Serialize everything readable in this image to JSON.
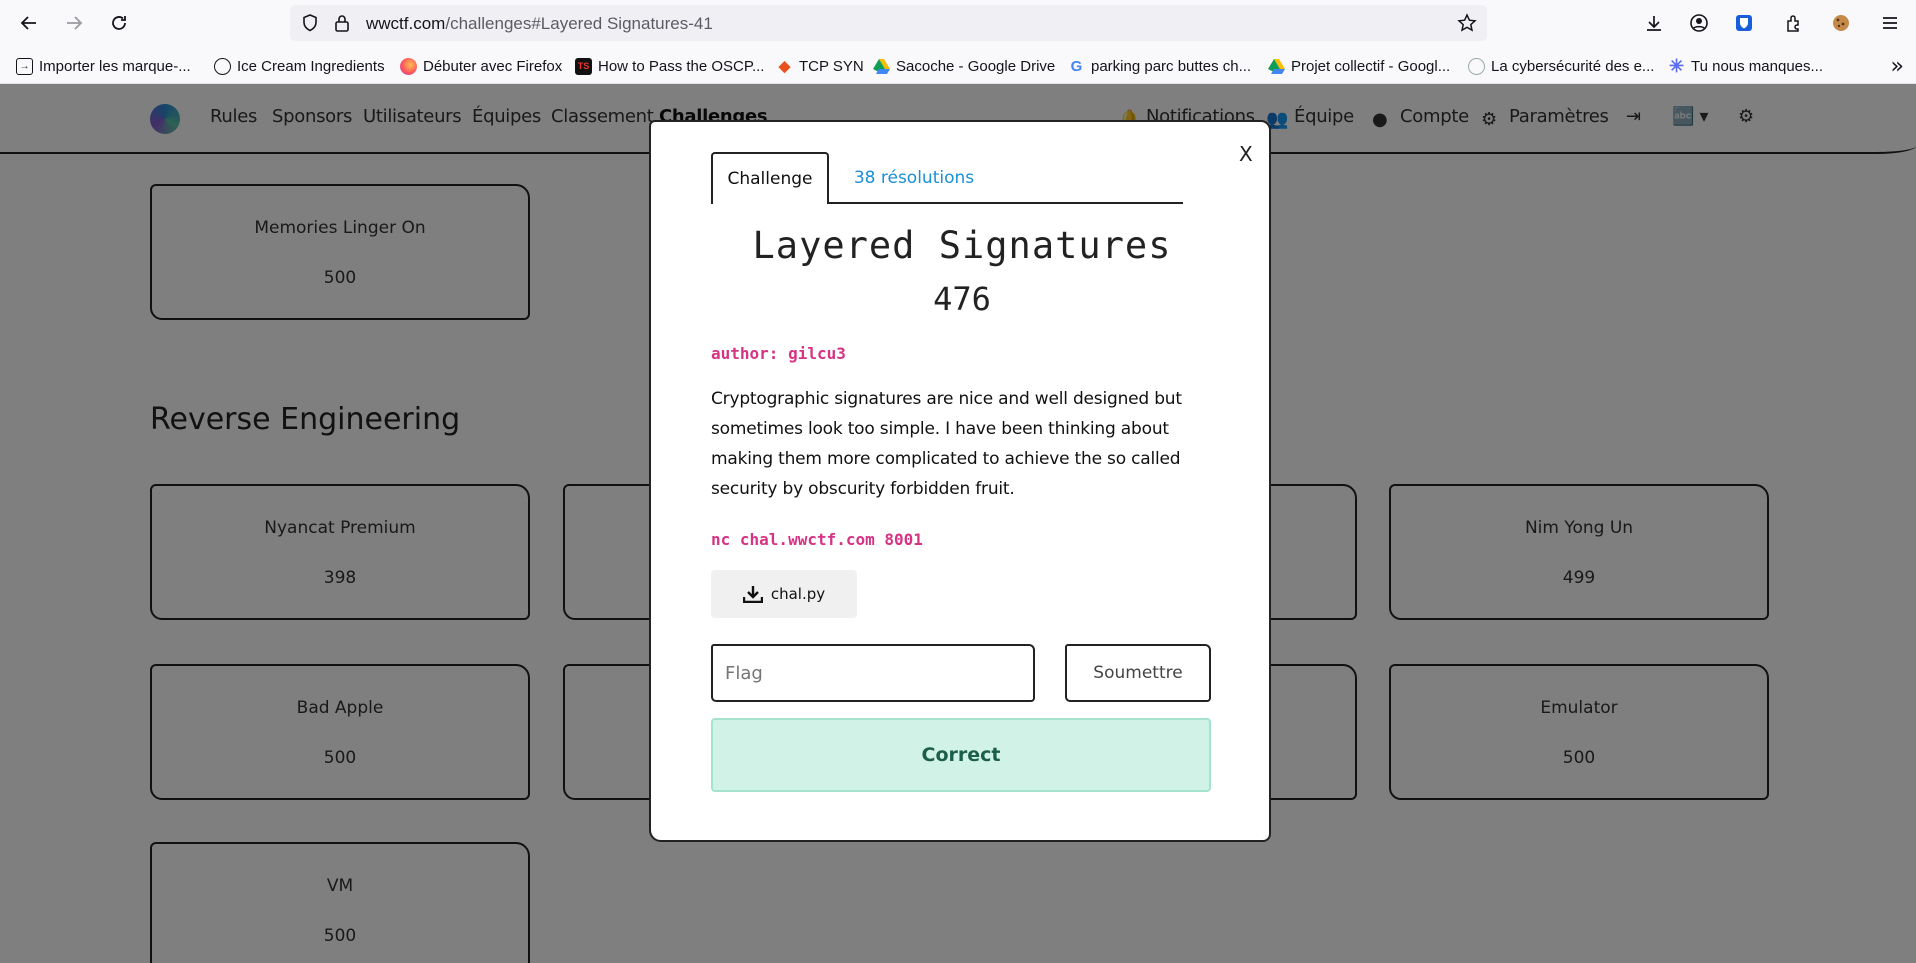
{
  "browser": {
    "url_host": "wwctf.com",
    "url_path": "/challenges#Layered Signatures-41",
    "icons": [
      "back-icon",
      "forward-icon",
      "reload-icon",
      "shield-icon",
      "lock-icon",
      "star-icon",
      "download-icon",
      "account-icon",
      "bitwarden-icon",
      "extensions-icon",
      "cookie-icon",
      "menu-icon"
    ],
    "bookmarks": [
      {
        "label": "Importer les marque-...",
        "icon": "import-icon"
      },
      {
        "label": "Ice Cream Ingredients",
        "icon": "globe-icon"
      },
      {
        "label": "Débuter avec Firefox",
        "icon": "firefox-icon"
      },
      {
        "label": "How to Pass the OSCP...",
        "icon": "tcm-icon"
      },
      {
        "label": "TCP SYN",
        "icon": "tcp-icon"
      },
      {
        "label": "Sacoche - Google Drive",
        "icon": "google-drive-icon"
      },
      {
        "label": "parking parc buttes ch...",
        "icon": "google-icon"
      },
      {
        "label": "Projet collectif - Googl...",
        "icon": "google-drive-icon"
      },
      {
        "label": "La cybersécurité des e...",
        "icon": "cyber-icon"
      },
      {
        "label": "Tu nous manques...",
        "icon": "asterisk-icon"
      }
    ],
    "bookmarks_more": "»"
  },
  "nav": {
    "items": [
      "Rules",
      "Sponsors",
      "Utilisateurs",
      "Équipes",
      "Classement",
      "Challenges"
    ],
    "right": {
      "notifications": "Notifications",
      "team": "Équipe",
      "account": "Compte",
      "settings": "Paramètres"
    }
  },
  "board": {
    "section_title": "Reverse Engineering",
    "cards": [
      {
        "name": "Memories Linger On",
        "points": "500"
      },
      {
        "name": "Nyancat Premium",
        "points": "398"
      },
      {
        "name": "Nim Yong Un",
        "points": "499"
      },
      {
        "name": "Bad Apple",
        "points": "500"
      },
      {
        "name": "Emulator",
        "points": "500"
      },
      {
        "name": "VM",
        "points": "500"
      }
    ]
  },
  "modal": {
    "close_label": "X",
    "tab_challenge": "Challenge",
    "tab_solves": "38 résolutions",
    "title": "Layered Signatures",
    "points": "476",
    "author": "author: gilcu3",
    "description": "Cryptographic signatures are nice and well designed but sometimes look too simple. I have been thinking about making them more complicated to achieve the so called security by obscurity forbidden fruit.",
    "command": "nc chal.wwctf.com 8001",
    "file_label": "chal.py",
    "flag_placeholder": "Flag",
    "submit_label": "Soumettre",
    "result": "Correct",
    "result_color": "#d1f2e7"
  },
  "colors": {
    "accent_link": "#1a8fd6",
    "code_pink": "#d63384",
    "success_text": "#1b5e4a"
  }
}
